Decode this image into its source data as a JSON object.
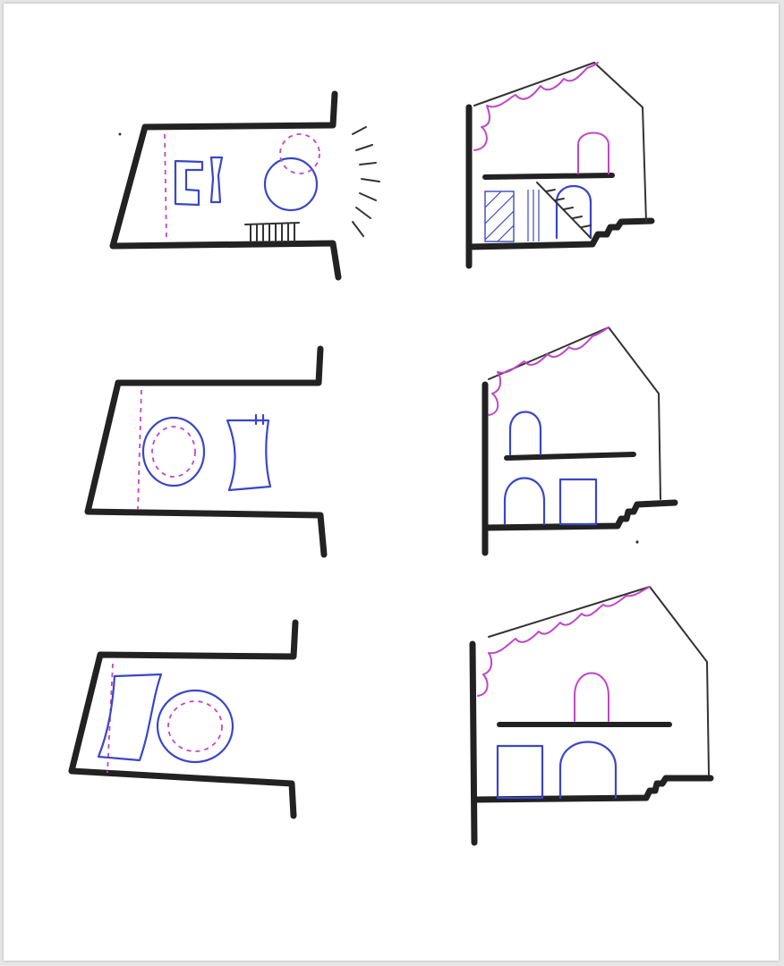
{
  "sketches": {
    "plans": [
      "plan-top",
      "plan-middle",
      "plan-bottom"
    ],
    "sections": [
      "section-top",
      "section-middle",
      "section-bottom"
    ]
  },
  "colors": {
    "wall": "#222222",
    "furniture": "#3a46c8",
    "ceiling_and_dashed": "#c046c8",
    "paper": "#ffffff"
  }
}
